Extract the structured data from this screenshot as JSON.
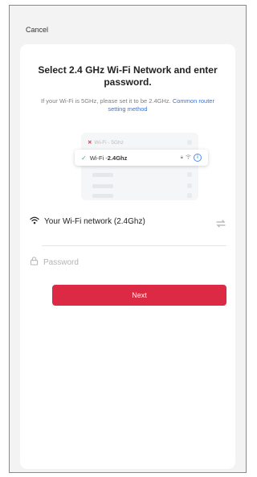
{
  "header": {
    "cancel_label": "Cancel"
  },
  "content": {
    "title": "Select 2.4 GHz Wi-Fi Network and enter password.",
    "subtitle_text": "If your Wi-Fi is 5GHz, please set it to be 2.4GHz. ",
    "subtitle_link": "Common router setting method"
  },
  "illustration": {
    "rejected_network": "Wi-Fi - 5Ghz",
    "selected_prefix": "Wi-Fi - ",
    "selected_band": "2.4Ghz",
    "reject_icon": "x-mark-icon",
    "accept_icon": "check-icon"
  },
  "form": {
    "network_value": "Your Wi-Fi network (2.4Ghz)",
    "password_placeholder": "Password",
    "network_icon": "wifi-icon",
    "password_icon": "lock-icon",
    "switch_icon": "switch-network-icon"
  },
  "actions": {
    "next_label": "Next"
  },
  "colors": {
    "primary": "#dc2a44",
    "link": "#3b73d9",
    "success": "#3bb36a",
    "reject": "#e2263c"
  }
}
